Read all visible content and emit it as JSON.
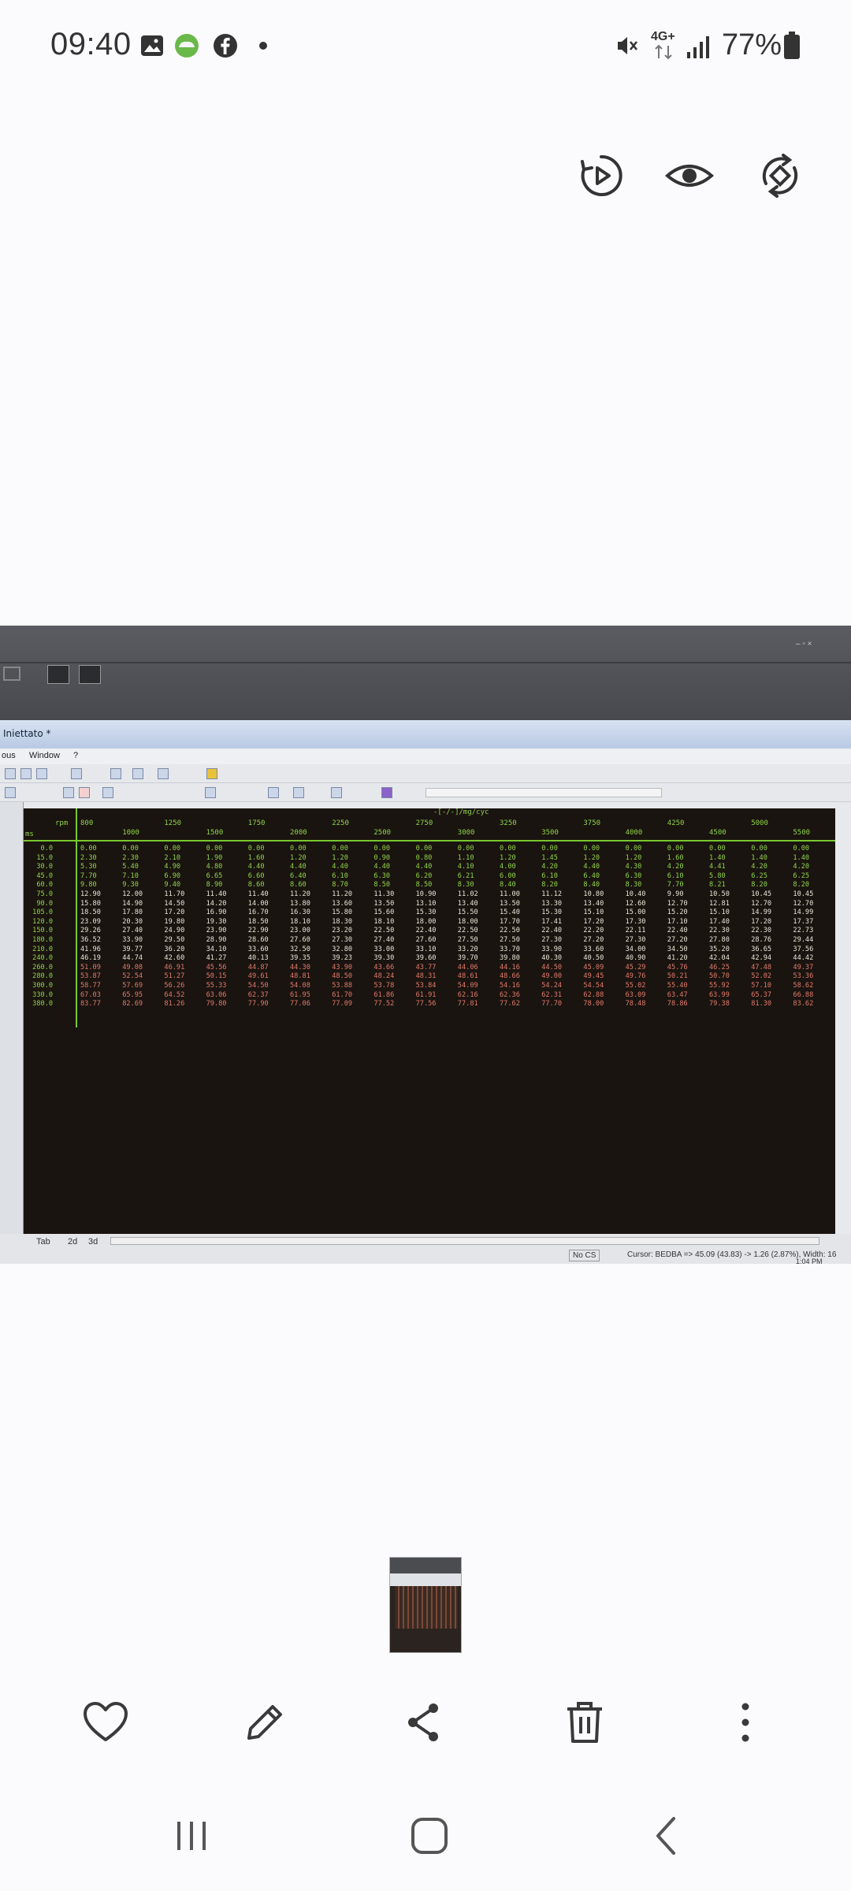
{
  "status_bar": {
    "time": "09:40",
    "notification_icons": [
      "image-icon",
      "cloud-app-icon",
      "facebook-icon",
      "dot-icon"
    ],
    "right_icons": [
      "mute-icon",
      "network-4g-icon",
      "signal-icon",
      "battery-icon"
    ],
    "network_label": "4G+",
    "battery": "77%"
  },
  "viewer_actions": [
    "motion-photo-icon",
    "eye-icon",
    "rotate-icon"
  ],
  "photo": {
    "window_title": "Iniettato *",
    "menu": [
      "ous",
      "Window",
      "?"
    ],
    "unit_label": "-[-/-]/mg/cyc",
    "row_header_label": "rpm",
    "row_axis_label": "ms",
    "rpm": [
      "800",
      "1000",
      "1250",
      "1500",
      "1750",
      "2000",
      "2250",
      "2500",
      "2750",
      "3000",
      "3250",
      "3500",
      "3750",
      "4000",
      "4250",
      "4500",
      "5000",
      "5500"
    ],
    "load": [
      "0.0",
      "15.0",
      "30.0",
      "45.0",
      "60.0",
      "75.0",
      "90.0",
      "105.0",
      "120.0",
      "150.0",
      "180.0",
      "210.0",
      "240.0",
      "260.0",
      "280.0",
      "300.0",
      "330.0",
      "380.0"
    ],
    "rows": [
      [
        "0.00",
        "0.00",
        "0.00",
        "0.00",
        "0.00",
        "0.00",
        "0.00",
        "0.00",
        "0.00",
        "0.00",
        "0.00",
        "0.00",
        "0.00",
        "0.00",
        "0.00",
        "0.00",
        "0.00",
        "0.00"
      ],
      [
        "2.30",
        "2.30",
        "2.10",
        "1.90",
        "1.60",
        "1.20",
        "1.20",
        "0.90",
        "0.80",
        "1.10",
        "1.20",
        "1.45",
        "1.20",
        "1.20",
        "1.60",
        "1.40",
        "1.40",
        "1.40"
      ],
      [
        "5.30",
        "5.40",
        "4.90",
        "4.80",
        "4.40",
        "4.40",
        "4.40",
        "4.40",
        "4.40",
        "4.10",
        "4.00",
        "4.20",
        "4.40",
        "4.30",
        "4.20",
        "4.41",
        "4.20",
        "4.20"
      ],
      [
        "7.70",
        "7.10",
        "6.90",
        "6.65",
        "6.60",
        "6.40",
        "6.10",
        "6.30",
        "6.20",
        "6.21",
        "6.00",
        "6.10",
        "6.40",
        "6.30",
        "6.10",
        "5.80",
        "6.25",
        "6.25"
      ],
      [
        "9.80",
        "9.30",
        "9.40",
        "8.90",
        "8.60",
        "8.60",
        "8.70",
        "8.50",
        "8.50",
        "8.30",
        "8.40",
        "8.20",
        "8.40",
        "8.30",
        "7.70",
        "8.21",
        "8.20",
        "8.20"
      ],
      [
        "12.90",
        "12.00",
        "11.70",
        "11.40",
        "11.40",
        "11.20",
        "11.20",
        "11.30",
        "10.90",
        "11.02",
        "11.00",
        "11.12",
        "10.80",
        "10.40",
        "9.90",
        "10.50",
        "10.45",
        "10.45"
      ],
      [
        "15.80",
        "14.90",
        "14.50",
        "14.20",
        "14.00",
        "13.80",
        "13.60",
        "13.50",
        "13.10",
        "13.40",
        "13.50",
        "13.30",
        "13.40",
        "12.60",
        "12.70",
        "12.81",
        "12.70",
        "12.70"
      ],
      [
        "18.50",
        "17.80",
        "17.20",
        "16.90",
        "16.70",
        "16.30",
        "15.80",
        "15.60",
        "15.30",
        "15.50",
        "15.40",
        "15.30",
        "15.10",
        "15.00",
        "15.20",
        "15.10",
        "14.99",
        "14.99"
      ],
      [
        "23.09",
        "20.30",
        "19.80",
        "19.30",
        "18.50",
        "18.10",
        "18.30",
        "18.10",
        "18.00",
        "18.00",
        "17.70",
        "17.41",
        "17.20",
        "17.30",
        "17.10",
        "17.40",
        "17.20",
        "17.37"
      ],
      [
        "29.26",
        "27.40",
        "24.90",
        "23.90",
        "22.90",
        "23.00",
        "23.20",
        "22.50",
        "22.40",
        "22.50",
        "22.50",
        "22.40",
        "22.20",
        "22.11",
        "22.40",
        "22.30",
        "22.30",
        "22.73"
      ],
      [
        "36.52",
        "33.90",
        "29.50",
        "28.90",
        "28.60",
        "27.60",
        "27.30",
        "27.40",
        "27.60",
        "27.50",
        "27.50",
        "27.30",
        "27.20",
        "27.30",
        "27.20",
        "27.80",
        "28.76",
        "29.44"
      ],
      [
        "41.96",
        "39.77",
        "36.20",
        "34.10",
        "33.60",
        "32.50",
        "32.80",
        "33.00",
        "33.10",
        "33.20",
        "33.70",
        "33.90",
        "33.60",
        "34.00",
        "34.50",
        "35.20",
        "36.65",
        "37.56"
      ],
      [
        "46.19",
        "44.74",
        "42.60",
        "41.27",
        "40.13",
        "39.35",
        "39.23",
        "39.30",
        "39.60",
        "39.70",
        "39.80",
        "40.30",
        "40.50",
        "40.90",
        "41.20",
        "42.04",
        "42.94",
        "44.42"
      ],
      [
        "51.09",
        "49.08",
        "46.91",
        "45.56",
        "44.87",
        "44.30",
        "43.90",
        "43.66",
        "43.77",
        "44.06",
        "44.16",
        "44.50",
        "45.09",
        "45.29",
        "45.76",
        "46.25",
        "47.48",
        "49.37"
      ],
      [
        "53.87",
        "52.54",
        "51.27",
        "50.15",
        "49.61",
        "48.81",
        "48.50",
        "48.24",
        "48.31",
        "48.61",
        "48.66",
        "49.00",
        "49.45",
        "49.76",
        "50.21",
        "50.70",
        "52.02",
        "53.36"
      ],
      [
        "58.77",
        "57.69",
        "56.26",
        "55.33",
        "54.50",
        "54.08",
        "53.88",
        "53.78",
        "53.84",
        "54.09",
        "54.16",
        "54.24",
        "54.54",
        "55.02",
        "55.40",
        "55.92",
        "57.10",
        "58.62"
      ],
      [
        "67.03",
        "65.95",
        "64.52",
        "63.06",
        "62.37",
        "61.95",
        "61.70",
        "61.86",
        "61.91",
        "62.16",
        "62.36",
        "62.31",
        "62.88",
        "63.09",
        "63.47",
        "63.99",
        "65.37",
        "66.88"
      ],
      [
        "83.77",
        "82.69",
        "81.26",
        "79.80",
        "77.90",
        "77.06",
        "77.09",
        "77.52",
        "77.56",
        "77.81",
        "77.62",
        "77.70",
        "78.00",
        "78.48",
        "78.86",
        "79.38",
        "81.30",
        "83.62"
      ]
    ],
    "view_tabs": [
      "Tab",
      "2d",
      "3d"
    ],
    "status_no_cs": "No CS",
    "status_cursor": "Cursor: BEDBA => 45.09 (43.83) -> 1.26 (2.87%), Width: 16",
    "clock": "1:04 PM"
  },
  "bottom_actions": [
    "favorite-icon",
    "edit-icon",
    "share-icon",
    "delete-icon",
    "more-icon"
  ],
  "nav_bar": [
    "recents-icon",
    "home-icon",
    "back-icon"
  ],
  "colors": {
    "grid_green": "#8fd44a",
    "grid_white": "#e9e4d6",
    "grid_red": "#e07a6a",
    "icon": "#3a3a3a"
  }
}
